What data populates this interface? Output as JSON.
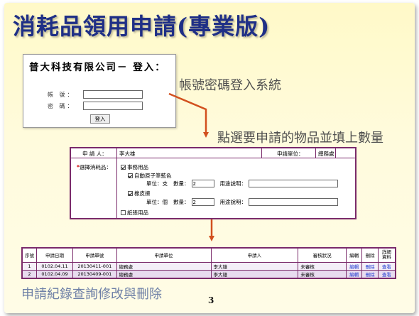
{
  "slide": {
    "title": "消耗品領用申請(專業版)",
    "page_number": "3"
  },
  "login": {
    "company": "普大科技有限公司－ 登入：",
    "account_label": "帳 號：",
    "password_label": "密 碼：",
    "account_value": "",
    "password_value": "",
    "submit_label": "登入"
  },
  "captions": {
    "login": "帳號密碼登入系統",
    "select": "點選要申請的物品並填上數量",
    "records": "申請紀錄查詢修改與刪除"
  },
  "form": {
    "applicant_label": "申 請 人：",
    "applicant_value": "李大雄",
    "unit_label": "申請單位：",
    "unit_value": "總務處",
    "select_required": "*",
    "select_label": "選擇消耗品：",
    "category1": "事務用品",
    "item1": "自動原子筆藍色",
    "item1_unit_label": "單位：支",
    "item1_qty_label": "數量：",
    "item1_qty": "2",
    "item1_purpose_label": "用途說明：",
    "item1_purpose": "",
    "item2": "橡皮擦",
    "item2_unit_label": "單位：個",
    "item2_qty_label": "數量：",
    "item2_qty": "2",
    "item2_purpose_label": "用途說明：",
    "item2_purpose": "",
    "category2": "紙張用品"
  },
  "records": {
    "headers": [
      "序號",
      "申請日期",
      "申請單號",
      "申請單位",
      "申請人",
      "審核狀況",
      "編輯",
      "刪除",
      "詳細\n資料"
    ],
    "rows": [
      [
        "1",
        "0102.04.11",
        "20130411-001",
        "總務處",
        "李大雄",
        "未審核",
        "編輯",
        "刪除",
        "查看"
      ],
      [
        "2",
        "0102.04.09",
        "20130409-001",
        "總務處",
        "李大雄",
        "未審核",
        "編輯",
        "刪除",
        "查看"
      ]
    ]
  },
  "colors": {
    "title": "#1f2f86",
    "border": "#7a2a6a",
    "arrow": "#d2501e",
    "required": "#d00000",
    "link": "#1f3ad0"
  }
}
